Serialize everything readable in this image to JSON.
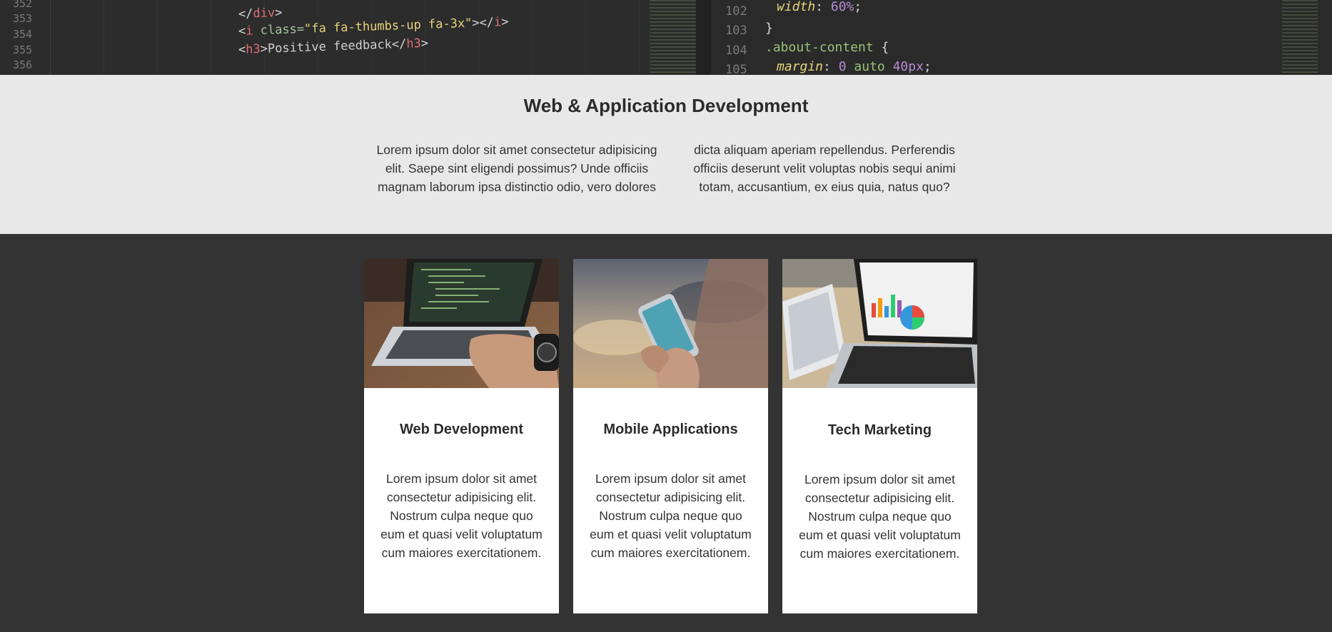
{
  "code_banner": {
    "left_lines": [
      {
        "num": "352"
      },
      {
        "num": "353"
      },
      {
        "num": "354"
      },
      {
        "num": "355"
      },
      {
        "num": "356"
      }
    ],
    "left_code": {
      "l1_close": "</",
      "l1_tag": "div",
      "l1_end": ">",
      "l2_open": "<",
      "l2_tag": "i",
      "l2_attr": " class=",
      "l2_str": "\"fa fa-thumbs-up fa-3x\"",
      "l2_mid": "></",
      "l2_tag2": "i",
      "l2_end": ">",
      "l3_open": "<",
      "l3_tag": "h3",
      "l3_gt": ">",
      "l3_text": "Positive feedback",
      "l3_close": "</",
      "l3_tag2": "h3",
      "l3_end": ">"
    },
    "right_lines": [
      {
        "num": "102"
      },
      {
        "num": "103"
      },
      {
        "num": "104"
      },
      {
        "num": "105"
      }
    ],
    "right_code": {
      "r1_prop": "width",
      "r1_colon": ": ",
      "r1_val": "60%",
      "r1_semi": ";",
      "r2": "}",
      "r3_sel": ".about-content",
      "r3_brace": " {",
      "r4_prop": "margin",
      "r4_colon": ": ",
      "r4_val1": "0",
      "r4_auto": " auto ",
      "r4_val2": "40px",
      "r4_semi": ";"
    }
  },
  "intro": {
    "title": "Web & Application Development",
    "col1": "Lorem ipsum dolor sit amet consectetur adipisicing elit. Saepe sint eligendi possimus? Unde officiis magnam laborum ipsa distinctio odio, vero dolores",
    "col2": "dicta aliquam aperiam repellendus. Perferendis officiis deserunt velit voluptas nobis sequi animi totam, accusantium, ex eius quia, natus quo?"
  },
  "cards": [
    {
      "title": "Web Development",
      "text": "Lorem ipsum dolor sit amet consectetur adipisicing elit. Nostrum culpa neque quo eum et quasi velit voluptatum cum maiores exercitationem.",
      "image": "laptop-coding-photo"
    },
    {
      "title": "Mobile Applications",
      "text": "Lorem ipsum dolor sit amet consectetur adipisicing elit. Nostrum culpa neque quo eum et quasi velit voluptatum cum maiores exercitationem.",
      "image": "smartphone-hands-photo"
    },
    {
      "title": "Tech Marketing",
      "text": "Lorem ipsum dolor sit amet consectetur adipisicing elit. Nostrum culpa neque quo eum et quasi velit voluptatum cum maiores exercitationem.",
      "image": "laptop-charts-photo"
    }
  ],
  "colors": {
    "page_bg": "#333333",
    "intro_bg": "#e8e8e8",
    "card_bg": "#ffffff",
    "heading": "#2b2b2b"
  }
}
